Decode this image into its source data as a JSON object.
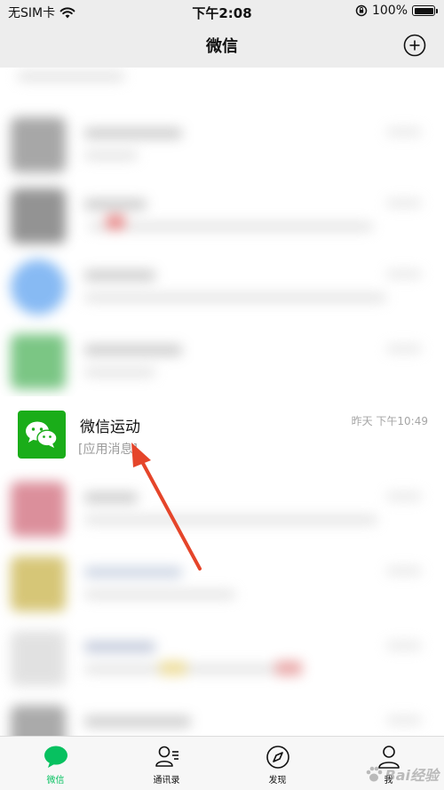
{
  "status_bar": {
    "carrier": "无SIM卡",
    "time": "下午2:08",
    "battery_text": "100%",
    "battery_level": 1.0
  },
  "nav": {
    "title": "微信",
    "add_icon": "plus-circle-icon"
  },
  "highlighted_chat": {
    "name": "微信运动",
    "preview": "[应用消息]",
    "time": "昨天 下午10:49",
    "avatar_color": "#1aad19"
  },
  "tabs": [
    {
      "label": "微信",
      "icon": "chat-bubble-icon",
      "active": true
    },
    {
      "label": "通讯录",
      "icon": "contacts-icon",
      "active": false
    },
    {
      "label": "发现",
      "icon": "compass-icon",
      "active": false
    },
    {
      "label": "我",
      "icon": "person-icon",
      "active": false
    }
  ],
  "colors": {
    "accent": "#07c160",
    "arrow": "#e5452a",
    "nav_bg": "#ededed"
  }
}
